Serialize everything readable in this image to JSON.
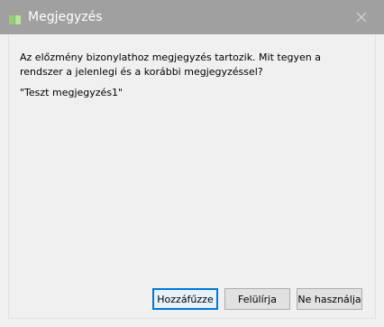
{
  "window": {
    "title": "Megjegyzés",
    "icon": "app-green-icon",
    "close_icon": "close-icon"
  },
  "dialog": {
    "message": "Az előzmény bizonylathoz megjegyzés tartozik. Mit tegyen a rendszer a jelenlegi és a korábbi megjegyzéssel?",
    "note": "\"Teszt megjegyzés1\""
  },
  "buttons": {
    "append": "Hozzáfűzze",
    "overwrite": "Felülírja",
    "ignore": "Ne használja"
  },
  "colors": {
    "titlebar": "#a0a0a0",
    "accent": "#0078d7"
  }
}
